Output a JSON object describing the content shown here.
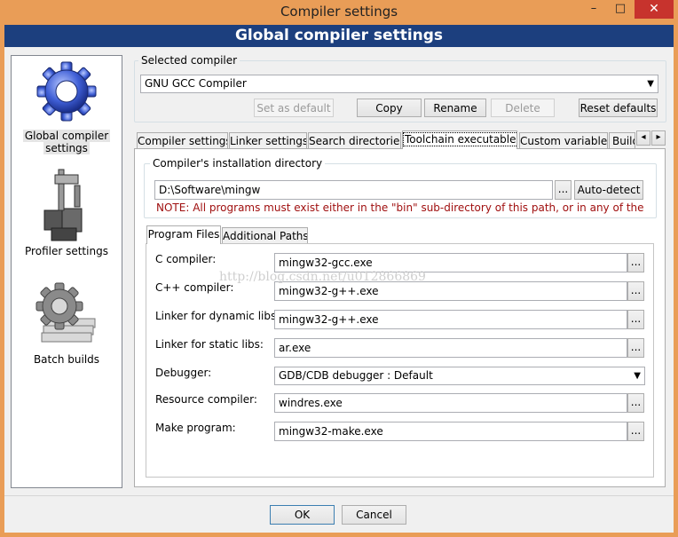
{
  "window": {
    "title": "Compiler settings",
    "minimize": "–",
    "maximize": "□",
    "close": "✕"
  },
  "banner": "Global compiler settings",
  "nav": [
    {
      "label_lines": [
        "Global compiler",
        "settings"
      ],
      "icon": "gear-icon"
    },
    {
      "label_lines": [
        "Profiler settings"
      ],
      "icon": "profiler-icon"
    },
    {
      "label_lines": [
        "Batch builds"
      ],
      "icon": "batch-builds-icon"
    }
  ],
  "selected_compiler": {
    "group_label": "Selected compiler",
    "value": "GNU GCC Compiler",
    "buttons": {
      "set_default": "Set as default",
      "copy": "Copy",
      "rename": "Rename",
      "delete": "Delete",
      "reset": "Reset defaults"
    }
  },
  "tabs": [
    "Compiler settings",
    "Linker settings",
    "Search directories",
    "Toolchain executables",
    "Custom variables",
    "Build"
  ],
  "tab_scroll": {
    "left": "◂",
    "right": "▸"
  },
  "install_dir": {
    "group_label": "Compiler's installation directory",
    "value": "D:\\Software\\mingw",
    "browse": "...",
    "autodetect": "Auto-detect",
    "note": "NOTE: All programs must exist either in the \"bin\" sub-directory of this path, or in any of the"
  },
  "subtabs": [
    "Program Files",
    "Additional Paths"
  ],
  "programs": [
    {
      "label": "C compiler:",
      "value": "mingw32-gcc.exe",
      "kind": "text"
    },
    {
      "label": "C++ compiler:",
      "value": "mingw32-g++.exe",
      "kind": "text"
    },
    {
      "label": "Linker for dynamic libs:",
      "value": "mingw32-g++.exe",
      "kind": "text"
    },
    {
      "label": "Linker for static libs:",
      "value": "ar.exe",
      "kind": "text"
    },
    {
      "label": "Debugger:",
      "value": "GDB/CDB debugger : Default",
      "kind": "select"
    },
    {
      "label": "Resource compiler:",
      "value": "windres.exe",
      "kind": "text"
    },
    {
      "label": "Make program:",
      "value": "mingw32-make.exe",
      "kind": "text"
    }
  ],
  "browse_label": "...",
  "watermark": "http://blog.csdn.net/u012866869",
  "footer": {
    "ok": "OK",
    "cancel": "Cancel"
  }
}
